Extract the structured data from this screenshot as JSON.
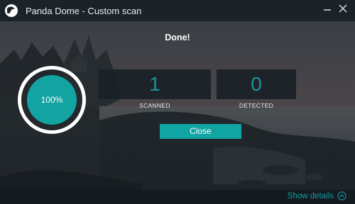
{
  "window": {
    "title": "Panda Dome - Custom scan"
  },
  "titlebar": {
    "minimize_icon": "minimize-icon",
    "close_icon": "close-icon"
  },
  "status": {
    "heading": "Done!"
  },
  "progress": {
    "value": 100,
    "label": "100%"
  },
  "stats": [
    {
      "value": "1",
      "label": "SCANNED"
    },
    {
      "value": "0",
      "label": "DETECTED"
    }
  ],
  "actions": {
    "close_label": "Close"
  },
  "footer": {
    "show_details_label": "Show details",
    "icon": "chevron-up-circle-icon"
  },
  "colors": {
    "accent": "#10a5a3",
    "titlebar": "#1b2228",
    "background": "#222a31"
  }
}
